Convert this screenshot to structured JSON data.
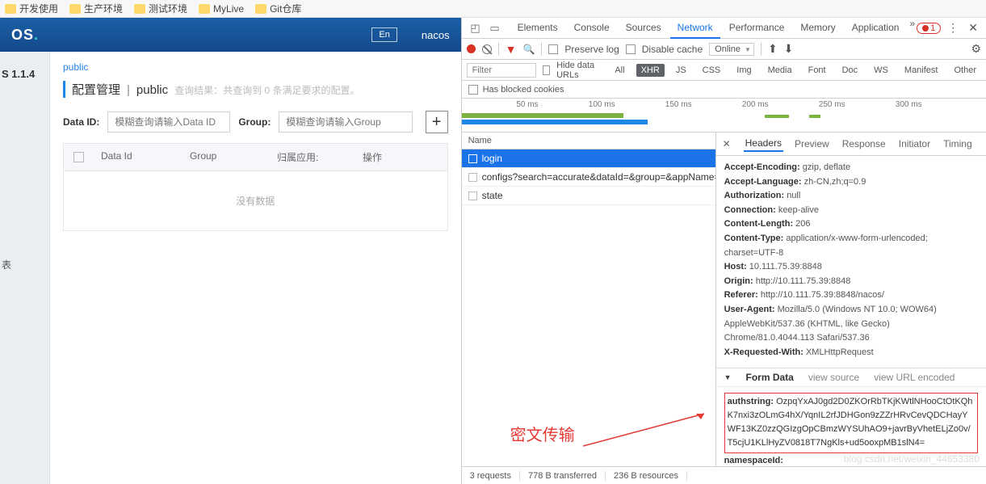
{
  "bookmarks": [
    "开发使用",
    "生产环境",
    "测试环境",
    "MyLive",
    "Git仓库"
  ],
  "nacos": {
    "logo": "OS",
    "lang": "En",
    "user": "nacos",
    "version": "S 1.1.4",
    "sidebar_item": "表",
    "tab": "public",
    "title_main": "配置管理",
    "title_sep": "|",
    "title_scope": "public",
    "title_hint": "查询结果：共查询到 0 条满足要求的配置。",
    "label_dataid": "Data ID:",
    "ph_dataid": "模糊查询请输入Data ID",
    "label_group": "Group:",
    "ph_group": "模糊查询请输入Group",
    "cols": {
      "dataid": "Data Id",
      "group": "Group",
      "app": "归属应用:",
      "op": "操作"
    },
    "nodata": "没有数据"
  },
  "devtools": {
    "tabs": [
      "Elements",
      "Console",
      "Sources",
      "Network",
      "Performance",
      "Memory",
      "Application"
    ],
    "active_tab": "Network",
    "warn_count": "1",
    "toolbar": {
      "preserve": "Preserve log",
      "disable": "Disable cache",
      "throttle": "Online"
    },
    "filter": {
      "placeholder": "Filter",
      "hide": "Hide data URLs",
      "types": [
        "All",
        "XHR",
        "JS",
        "CSS",
        "Img",
        "Media",
        "Font",
        "Doc",
        "WS",
        "Manifest",
        "Other"
      ],
      "selected": "XHR",
      "blocked": "Has blocked cookies"
    },
    "timeline_labels": [
      "50 ms",
      "100 ms",
      "150 ms",
      "200 ms",
      "250 ms",
      "300 ms"
    ],
    "requests": {
      "head": "Name",
      "items": [
        "login",
        "configs?search=accurate&dataId=&group=&appName=&co...",
        "state"
      ],
      "selected": 0
    },
    "detail_tabs": [
      "Headers",
      "Preview",
      "Response",
      "Initiator",
      "Timing"
    ],
    "detail_active": "Headers",
    "headers": [
      {
        "k": "Accept-Encoding",
        "v": "gzip, deflate"
      },
      {
        "k": "Accept-Language",
        "v": "zh-CN,zh;q=0.9"
      },
      {
        "k": "Authorization",
        "v": "null"
      },
      {
        "k": "Connection",
        "v": "keep-alive"
      },
      {
        "k": "Content-Length",
        "v": "206"
      },
      {
        "k": "Content-Type",
        "v": "application/x-www-form-urlencoded; charset=UTF-8"
      },
      {
        "k": "Host",
        "v": "10.111.75.39:8848"
      },
      {
        "k": "Origin",
        "v": "http://10.111.75.39:8848"
      },
      {
        "k": "Referer",
        "v": "http://10.111.75.39:8848/nacos/"
      },
      {
        "k": "User-Agent",
        "v": "Mozilla/5.0 (Windows NT 10.0; WOW64) AppleWebKit/537.36 (KHTML, like Gecko) Chrome/81.0.4044.113 Safari/537.36"
      },
      {
        "k": "X-Requested-With",
        "v": "XMLHttpRequest"
      }
    ],
    "form_section": {
      "name": "Form Data",
      "view_source": "view source",
      "view_url": "view URL encoded"
    },
    "form_data": {
      "authstring_label": "authstring:",
      "authstring": "OzpqYxAJ0gd2D0ZKOrRbTKjKWtlNHooCtOtKQhK7nxi3zOLmG4hX/YqnIL2rfJDHGon9zZZrHRvCevQDCHayYWF13KZ0zzQGIzgOpCBmzWYSUhAO9+javrByVhetELjZo0v/T5cjU1KLlHyZV0818T7NgKls+ud5ooxpMB1slN4=",
      "namespace_label": "namespaceId:"
    },
    "annotation": "密文传输",
    "status": {
      "reqs": "3 requests",
      "trans": "778 B transferred",
      "res": "236 B resources"
    },
    "watermark": "blog.csdn.net/weixin_44653380"
  }
}
